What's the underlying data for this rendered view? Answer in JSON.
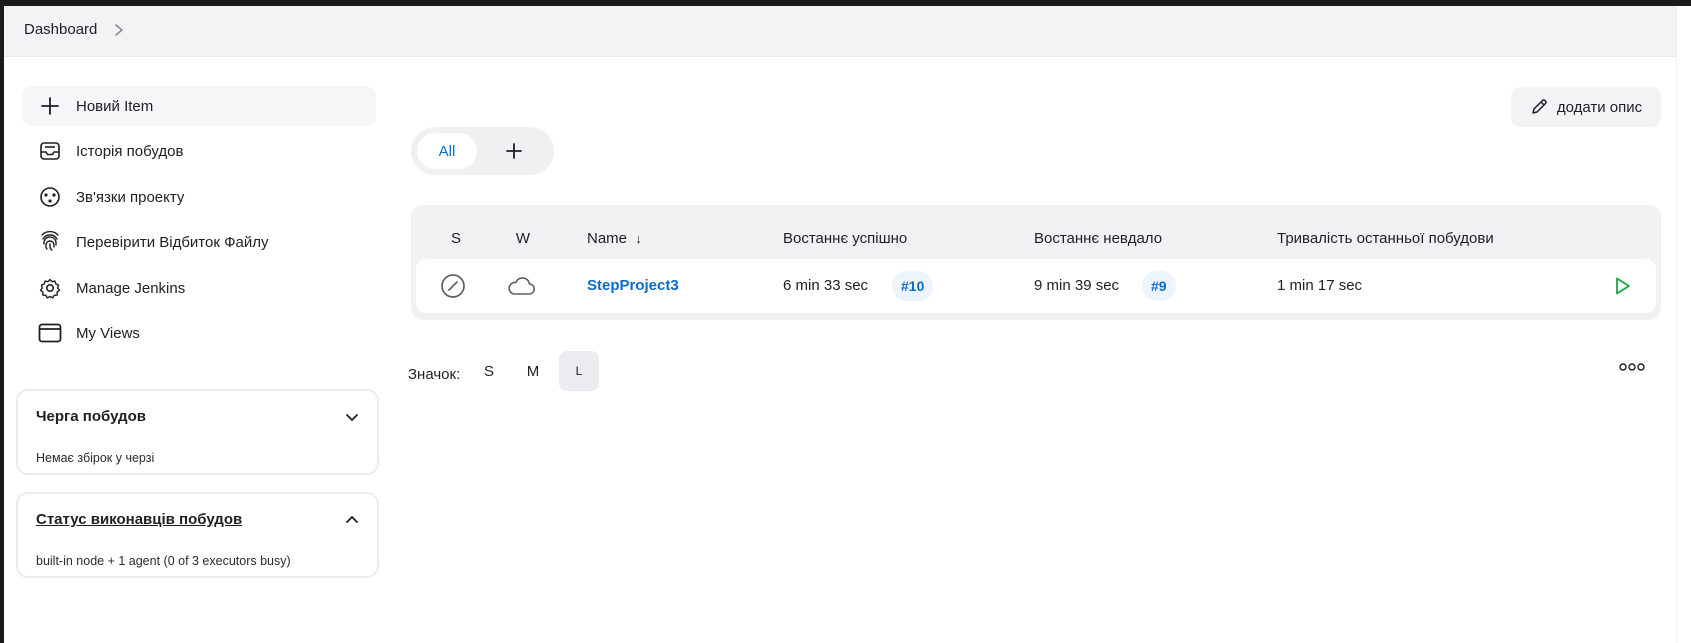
{
  "breadcrumb": {
    "dashboard": "Dashboard"
  },
  "sidebar": {
    "items": [
      {
        "label": "Новий Item",
        "icon": "plus-icon"
      },
      {
        "label": "Історія побудов",
        "icon": "inbox-icon"
      },
      {
        "label": "Зв'язки проекту",
        "icon": "relations-icon"
      },
      {
        "label": "Перевірити Відбиток Файлу",
        "icon": "fingerprint-icon"
      },
      {
        "label": "Manage Jenkins",
        "icon": "gear-icon"
      },
      {
        "label": "My Views",
        "icon": "window-icon"
      }
    ],
    "build_queue": {
      "title": "Черга побудов",
      "empty_text": "Немає збірок у черзі"
    },
    "executors": {
      "title": "Статус виконавців побудов",
      "summary": "built-in node + 1 agent (0 of 3 executors busy)"
    }
  },
  "main": {
    "add_description_label": "додати опис",
    "tabs": {
      "all": "All"
    },
    "table": {
      "headers": {
        "s": "S",
        "w": "W",
        "name": "Name",
        "name_sort": "↓",
        "last_success": "Востаннє успішно",
        "last_failure": "Востаннє невдало",
        "last_duration": "Тривалість останньої побудови"
      },
      "rows": [
        {
          "name": "StepProject3",
          "last_success_time": "6 min 33 sec",
          "last_success_build": "#10",
          "last_failure_time": "9 min 39 sec",
          "last_failure_build": "#9",
          "last_duration": "1 min 17 sec"
        }
      ]
    },
    "icon_size": {
      "label": "Значок:",
      "options": [
        "S",
        "M",
        "L"
      ],
      "selected": "L"
    }
  },
  "colors": {
    "link": "#0b6bcb",
    "run": "#1ea446",
    "status_gray": "#5f5f6a"
  }
}
